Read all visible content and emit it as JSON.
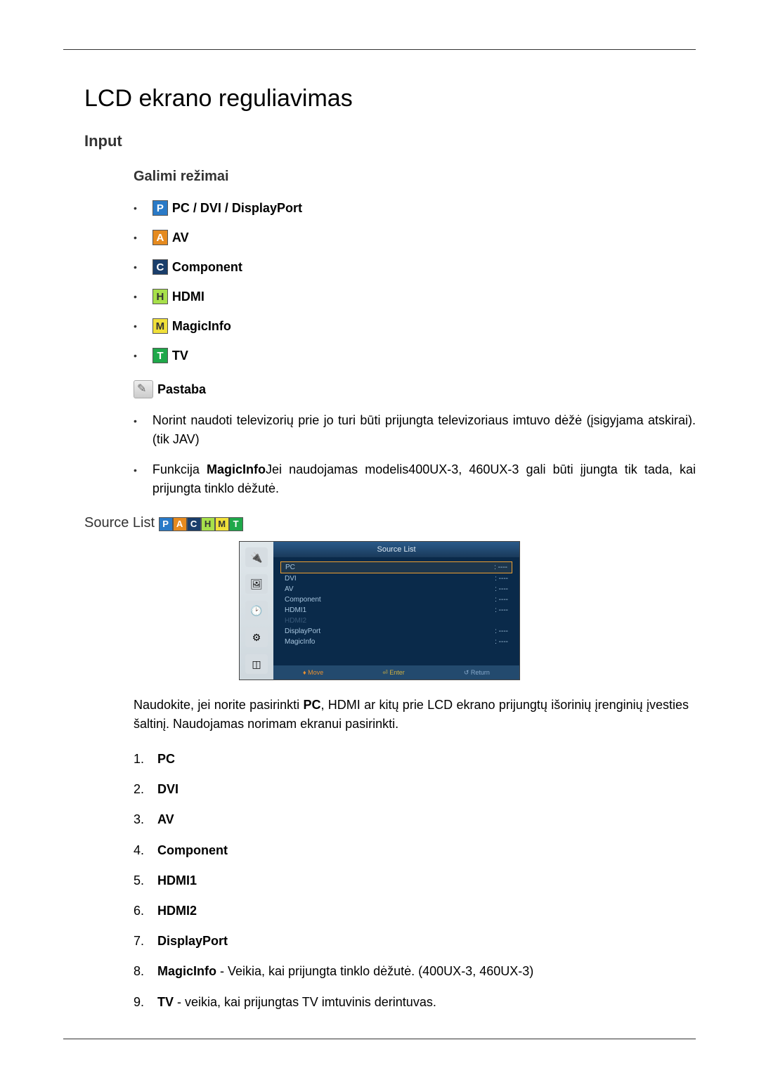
{
  "title": "LCD ekrano reguliavimas",
  "section_input": "Input",
  "modes_heading": "Galimi režimai",
  "modes": [
    {
      "badge": "P",
      "cls": "b-blue",
      "label": "PC / DVI / DisplayPort"
    },
    {
      "badge": "A",
      "cls": "b-orange",
      "label": "AV"
    },
    {
      "badge": "C",
      "cls": "b-navy",
      "label": "Component"
    },
    {
      "badge": "H",
      "cls": "b-lime",
      "label": "HDMI"
    },
    {
      "badge": "M",
      "cls": "b-yellow",
      "label": "MagicInfo"
    },
    {
      "badge": "T",
      "cls": "b-green",
      "label": "TV"
    }
  ],
  "note_label": "Pastaba",
  "notes": [
    {
      "text": "Norint naudoti televizorių prie jo turi būti prijungta televizoriaus imtuvo dėžė (įsigyjama atskirai). (tik JAV)"
    },
    {
      "pre": "Funkcija ",
      "bold": "MagicInfo",
      "post": "Jei naudojamas modelis400UX-3, 460UX-3 gali būti įjungta tik tada, kai prijungta tinklo dėžutė."
    }
  ],
  "source_list_heading": "Source List",
  "source_badges": [
    "P",
    "A",
    "C",
    "H",
    "M",
    "T"
  ],
  "screenshot": {
    "title": "Source List",
    "rows": [
      {
        "name": "PC",
        "val": ": ----",
        "sel": true
      },
      {
        "name": "DVI",
        "val": ": ----"
      },
      {
        "name": "AV",
        "val": ": ----"
      },
      {
        "name": "Component",
        "val": ": ----"
      },
      {
        "name": "HDMI1",
        "val": ": ----"
      },
      {
        "name": "HDMI2",
        "val": "",
        "dim": true
      },
      {
        "name": "DisplayPort",
        "val": ": ----"
      },
      {
        "name": "MagicInfo",
        "val": ": ----"
      }
    ],
    "footer": {
      "move": "Move",
      "enter": "Enter",
      "ret": "Return"
    }
  },
  "body_text_pre": "Naudokite, jei norite pasirinkti ",
  "body_text_bold": "PC",
  "body_text_post": ", HDMI ar kitų prie LCD ekrano prijungtų išorinių įrenginių įvesties šaltinį. Naudojamas norimam ekranui pasirinkti.",
  "ol": [
    {
      "bold": "PC"
    },
    {
      "bold": "DVI"
    },
    {
      "bold": "AV"
    },
    {
      "bold": "Component"
    },
    {
      "bold": "HDMI1"
    },
    {
      "bold": "HDMI2"
    },
    {
      "bold": "DisplayPort"
    },
    {
      "bold": "MagicInfo",
      "rest": " - Veikia, kai prijungta tinklo dėžutė. (400UX-3, 460UX-3)"
    },
    {
      "bold": "TV",
      "rest": " - veikia, kai prijungtas TV imtuvinis derintuvas."
    }
  ]
}
